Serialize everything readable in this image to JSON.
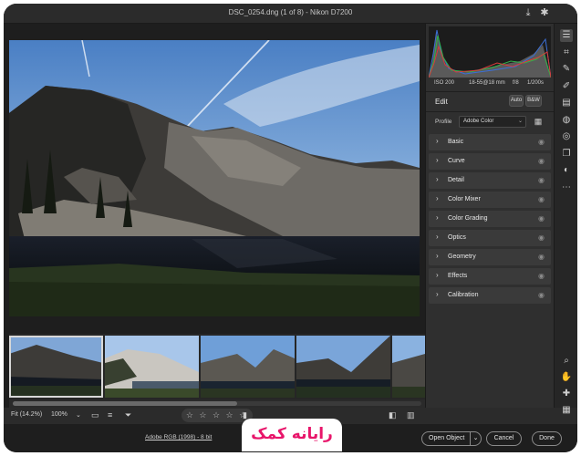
{
  "window": {
    "title": "DSC_0254.dng (1 of 8) - Nikon D7200"
  },
  "titlebar_icons": [
    "export-icon",
    "gear-icon"
  ],
  "exif": {
    "iso": "ISO 200",
    "lens": "18-55@18 mm",
    "aperture": "f/8",
    "shutter": "1/200s"
  },
  "edit": {
    "label": "Edit",
    "auto_label": "Auto",
    "bw_label": "B&W",
    "profile_label": "Profile",
    "profile_value": "Adobe Color"
  },
  "sections": [
    {
      "label": "Basic"
    },
    {
      "label": "Curve"
    },
    {
      "label": "Detail"
    },
    {
      "label": "Color Mixer"
    },
    {
      "label": "Color Grading"
    },
    {
      "label": "Optics"
    },
    {
      "label": "Geometry"
    },
    {
      "label": "Effects"
    },
    {
      "label": "Calibration"
    }
  ],
  "tools": [
    "sliders-icon",
    "crop-icon",
    "healing-icon",
    "brush-icon",
    "gradient-icon",
    "radial-icon",
    "red-eye-icon",
    "snapshots-icon",
    "presets-icon",
    "more-icon"
  ],
  "bottom_tools": [
    "zoom-icon",
    "hand-icon",
    "sampler-icon",
    "grid-icon"
  ],
  "bottombar": {
    "fit_label": "Fit (14.2%)",
    "zoom_value": "100%",
    "stars": "☆ ☆ ☆ ☆ ☆"
  },
  "status": {
    "workflow_info": "Adobe RGB (1998) - 8 bit"
  },
  "buttons": {
    "open_object": "Open Object",
    "cancel": "Cancel",
    "done": "Done"
  },
  "watermark": {
    "text": "رایانه کمک"
  },
  "colors": {
    "panel_bg": "#2f2f2f",
    "app_bg": "#1e1e1e",
    "brand_pink": "#e8156a"
  }
}
